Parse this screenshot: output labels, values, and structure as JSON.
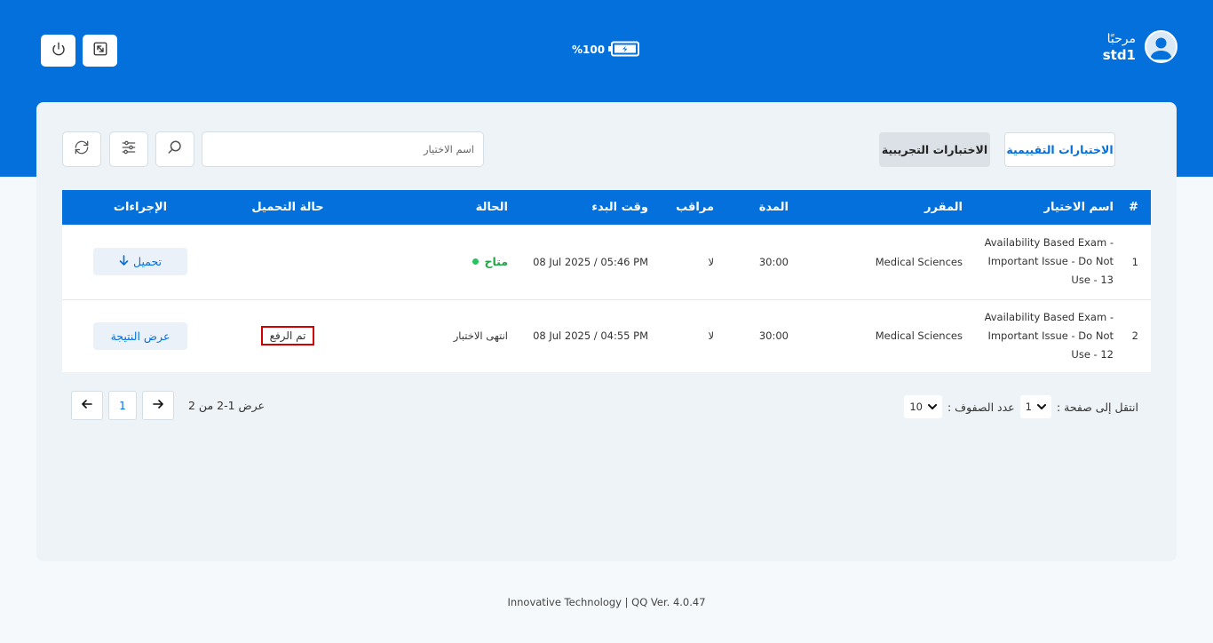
{
  "header": {
    "battery_text": "%100",
    "greeting": "مرحبًا",
    "username": "std1",
    "power_icon": "power-icon",
    "fullscreen_icon": "fullscreen-icon"
  },
  "tabs": {
    "assessment": "الاختبارات التقييمية",
    "practice": "الاختبارات التجريبية"
  },
  "search": {
    "placeholder": "اسم الاختيار"
  },
  "table": {
    "headers": {
      "num": "#",
      "name": "اسم الاختيار",
      "course": "المقرر",
      "duration": "المدة",
      "proctor": "مراقب",
      "start": "وقت البدء",
      "status": "الحالة",
      "upload": "حالة التحميل",
      "actions": "الإجراءات"
    },
    "rows": [
      {
        "num": "1",
        "name": "Availability Based Exam - Important Issue - Do Not Use - 13",
        "course": "Medical Sciences",
        "duration": "30:00",
        "proctor": "لا",
        "start": "08 Jul 2025 / 05:46 PM",
        "status": "متاح",
        "upload": "",
        "action": "تحميل"
      },
      {
        "num": "2",
        "name": "Availability Based Exam - Important Issue - Do Not Use - 12",
        "course": "Medical Sciences",
        "duration": "30:00",
        "proctor": "لا",
        "start": "08 Jul 2025 / 04:55 PM",
        "status": "انتهى الاختبار",
        "upload": "تم الرفع",
        "action": "عرض النتيجة"
      }
    ]
  },
  "pagination": {
    "goto_label": "انتقل إلى صفحة :",
    "goto_value": "1",
    "rows_label": "عدد الصفوف :",
    "rows_value": "10",
    "info": "عرض 1-2 من 2",
    "current_page": "1"
  },
  "footer": "Innovative Technology | QQ Ver. 4.0.47",
  "colors": {
    "primary": "#0470dc",
    "success": "#22a447",
    "highlight": "#d20000"
  }
}
